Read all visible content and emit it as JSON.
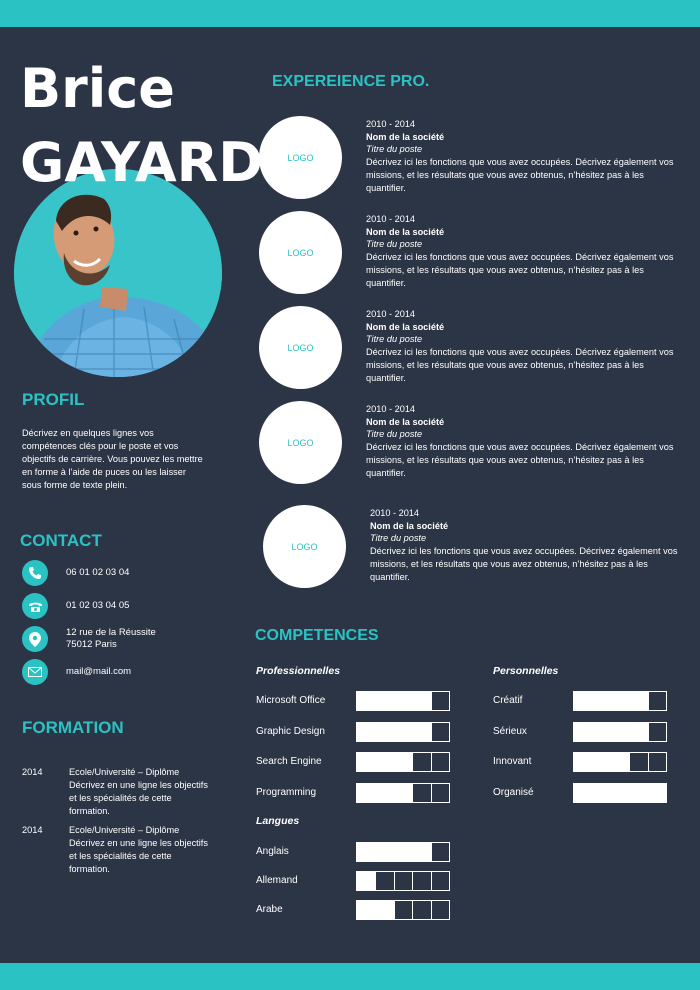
{
  "header": {
    "first_name": "Brice",
    "last_name": "GAYARD"
  },
  "profil": {
    "title": "PROFIL",
    "text": "Décrivez en quelques lignes vos compétences clés pour le poste et vos objectifs de carrière. Vous pouvez les mettre en forme à l’aide de puces ou les laisser sous forme de texte plein."
  },
  "contact": {
    "title": "CONTACT",
    "mobile": "06 01 02 03 04",
    "phone": "01 02 03 04 05",
    "address_line1": "12 rue de la Réussite",
    "address_line2": "75012 Paris",
    "email": "mail@mail.com",
    "icons": [
      "mobile-phone-icon",
      "telephone-icon",
      "location-pin-icon",
      "envelope-icon"
    ]
  },
  "formation": {
    "title": "FORMATION",
    "items": [
      {
        "year": "2014",
        "desc": "Ecole/Université – Diplôme Décrivez en une ligne les objectifs et les spécialités de cette formation."
      },
      {
        "year": "2014",
        "desc": "Ecole/Université – Diplôme Décrivez en une ligne les objectifs et les spécialités de cette formation."
      }
    ]
  },
  "experience": {
    "title": "EXPEREIENCE PRO.",
    "items": [
      {
        "logo": "LOGO",
        "dates": "2010 - 2014",
        "company": "Nom de la société",
        "position": "Titre du poste",
        "desc": "Décrivez ici les fonctions que vous avez occupées. Décrivez également vos missions, et les résultats que vous avez obtenus, n’hésitez pas à les quantifier."
      },
      {
        "logo": "LOGO",
        "dates": "2010 - 2014",
        "company": "Nom de la société",
        "position": "Titre du poste",
        "desc": "Décrivez ici les fonctions que vous avez occupées. Décrivez également vos missions, et les résultats que vous avez obtenus, n’hésitez pas à les quantifier."
      },
      {
        "logo": "LOGO",
        "dates": "2010 - 2014",
        "company": "Nom de la société",
        "position": "Titre du poste",
        "desc": "Décrivez ici les fonctions que vous avez occupées. Décrivez également vos missions, et les résultats que vous avez obtenus, n’hésitez pas à les quantifier."
      },
      {
        "logo": "LOGO",
        "dates": "2010 - 2014",
        "company": "Nom de la société",
        "position": "Titre du poste",
        "desc": "Décrivez ici les fonctions que vous avez occupées. Décrivez également vos missions, et les résultats que vous avez obtenus, n’hésitez pas à les quantifier."
      },
      {
        "logo": "LOGO",
        "dates": "2010 - 2014",
        "company": "Nom de la société",
        "position": "Titre du poste",
        "desc": "Décrivez ici les fonctions que vous avez occupées. Décrivez également vos missions, et les résultats que vous avez obtenus, n’hésitez pas à les quantifier."
      }
    ]
  },
  "competences": {
    "title": "COMPETENCES",
    "pro_title": "Professionnelles",
    "perso_title": "Personnelles",
    "langues_title": "Langues",
    "professional": [
      {
        "label": "Microsoft Office",
        "level": 4,
        "max": 5
      },
      {
        "label": "Graphic Design",
        "level": 4,
        "max": 5
      },
      {
        "label": "Search Engine",
        "level": 3,
        "max": 5
      },
      {
        "label": "Programming",
        "level": 3,
        "max": 5
      }
    ],
    "personal": [
      {
        "label": "Créatif",
        "level": 4,
        "max": 5
      },
      {
        "label": "Sérieux",
        "level": 4,
        "max": 5
      },
      {
        "label": "Innovant",
        "level": 3,
        "max": 5
      },
      {
        "label": "Organisé",
        "level": 5,
        "max": 5
      }
    ],
    "languages": [
      {
        "label": "Anglais",
        "level": 4,
        "max": 5
      },
      {
        "label": "Allemand",
        "level": 1,
        "max": 5
      },
      {
        "label": "Arabe",
        "level": 2,
        "max": 5
      }
    ]
  },
  "colors": {
    "accent": "#2bc2c4",
    "background": "#2c3545",
    "text": "#ffffff"
  }
}
